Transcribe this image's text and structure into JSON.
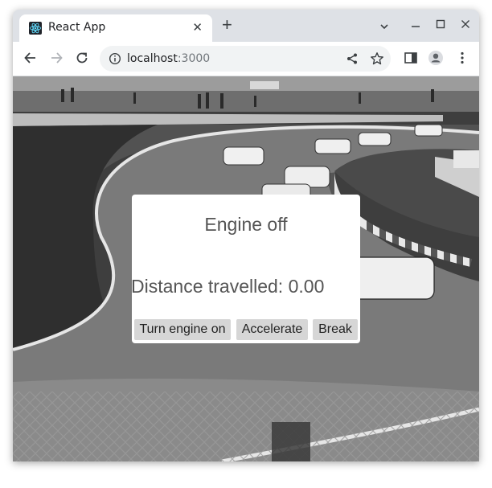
{
  "browser": {
    "tab_title": "React App",
    "tab_icon": "react-logo-icon",
    "url_host": "localhost",
    "url_port": ":3000"
  },
  "app": {
    "engine_status": "Engine off",
    "distance_text": "Distance travelled: 0.00",
    "buttons": {
      "engine": "Turn engine on",
      "accelerate": "Accelerate",
      "brake": "Break"
    }
  },
  "colors": {
    "react_blue": "#61dafb",
    "panel_bg": "#ffffff",
    "button_bg": "#d6d6d6"
  }
}
